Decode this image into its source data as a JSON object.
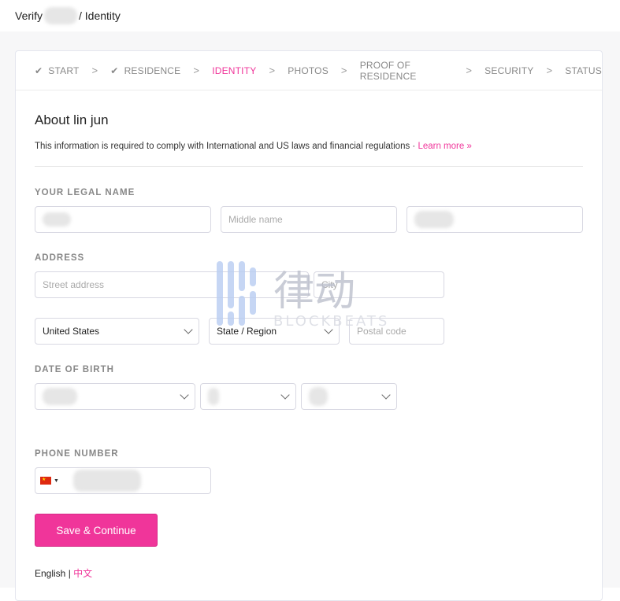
{
  "header": {
    "prefix": "Verify",
    "suffix": "/ Identity"
  },
  "steps": [
    {
      "label": "START",
      "done": true
    },
    {
      "label": "RESIDENCE",
      "done": true
    },
    {
      "label": "IDENTITY",
      "active": true
    },
    {
      "label": "PHOTOS"
    },
    {
      "label": "PROOF OF RESIDENCE"
    },
    {
      "label": "SECURITY"
    },
    {
      "label": "STATUS"
    }
  ],
  "section": {
    "title": "About lin jun",
    "info": "This information is required to comply with International and US laws and financial regulations · ",
    "learn_more": "Learn more »"
  },
  "legal_name": {
    "label": "YOUR LEGAL NAME",
    "middle_placeholder": "Middle name"
  },
  "address": {
    "label": "ADDRESS",
    "street_placeholder": "Street address",
    "city_placeholder": "City",
    "country": "United States",
    "state": "State / Region",
    "postal_placeholder": "Postal code"
  },
  "dob": {
    "label": "DATE OF BIRTH"
  },
  "phone": {
    "label": "PHONE NUMBER",
    "flag": "cn-flag-icon"
  },
  "save_label": "Save & Continue",
  "lang": {
    "en": "English",
    "sep": " | ",
    "zh": "中文"
  },
  "watermark": {
    "cn": "律动",
    "en": "BLOCKBEATS"
  },
  "colors": {
    "accent": "#f0359a"
  }
}
